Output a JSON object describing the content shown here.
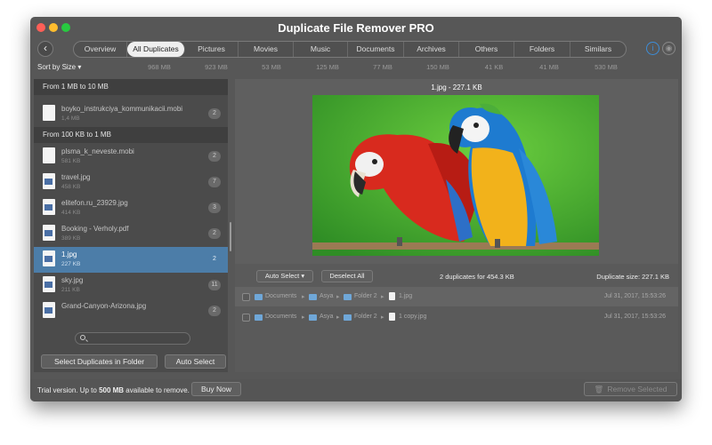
{
  "window": {
    "title": "Duplicate File Remover PRO"
  },
  "toolbar": {
    "back_label": "‹",
    "tabs": [
      "Overview",
      "All Duplicates",
      "Pictures",
      "Movies",
      "Music",
      "Documents",
      "Archives",
      "Others",
      "Folders",
      "Similars"
    ],
    "info_label": "i",
    "rss_label": "◉"
  },
  "sort": {
    "label": "Sort by Size ▾"
  },
  "sizes": [
    "968 MB",
    "923 MB",
    "53 MB",
    "125 MB",
    "77 MB",
    "150 MB",
    "41 KB",
    "41 MB",
    "530 MB"
  ],
  "groups": [
    {
      "header": "From 1 MB to 10 MB",
      "items": [
        {
          "name": "boyko_instrukciya_kommunikacii.mobi",
          "size": "1,4 MB",
          "count": "2"
        }
      ]
    },
    {
      "header": "From 100 KB to 1 MB",
      "items": [
        {
          "name": "plsma_k_neveste.mobi",
          "size": "581 KB",
          "count": "2"
        },
        {
          "name": "travel.jpg",
          "size": "458 KB",
          "count": "7"
        },
        {
          "name": "elitefon.ru_23929.jpg",
          "size": "414 KB",
          "count": "3"
        },
        {
          "name": "Booking - Verholy.pdf",
          "size": "389 KB",
          "count": "2"
        },
        {
          "name": "1.jpg",
          "size": "227 KB",
          "count": "2"
        },
        {
          "name": "sky.jpg",
          "size": "211 KB",
          "count": "11"
        },
        {
          "name": "Grand-Canyon-Arizona.jpg",
          "size": "",
          "count": "2"
        }
      ]
    }
  ],
  "left_buttons": {
    "select_in_folder": "Select Duplicates in Folder",
    "auto_select": "Auto Select"
  },
  "preview": {
    "title": "1.jpg - 227.1 KB"
  },
  "dup_bar": {
    "auto_select": "Auto Select ▾",
    "deselect_all": "Deselect All",
    "summary": "2 duplicates for 454.3 KB",
    "dup_size": "Duplicate size: 227.1 KB"
  },
  "paths": [
    {
      "crumbs": [
        "Documents",
        "Asya",
        "Folder 2",
        "1.jpg"
      ],
      "date": "Jul 31, 2017, 15:53:26"
    },
    {
      "crumbs": [
        "Documents",
        "Asya",
        "Folder 2",
        "1 copy.jpg"
      ],
      "date": "Jul 31, 2017, 15:53:26"
    }
  ],
  "status": {
    "trial_pre": "Trial version. Up to ",
    "trial_bold": "500 MB",
    "trial_post": " available to remove.",
    "buy_now": "Buy Now",
    "remove_selected": "Remove Selected"
  },
  "colors": {
    "accent": "#4c7da8",
    "info_blue": "#3d8dd8",
    "window_bg": "#575757"
  }
}
